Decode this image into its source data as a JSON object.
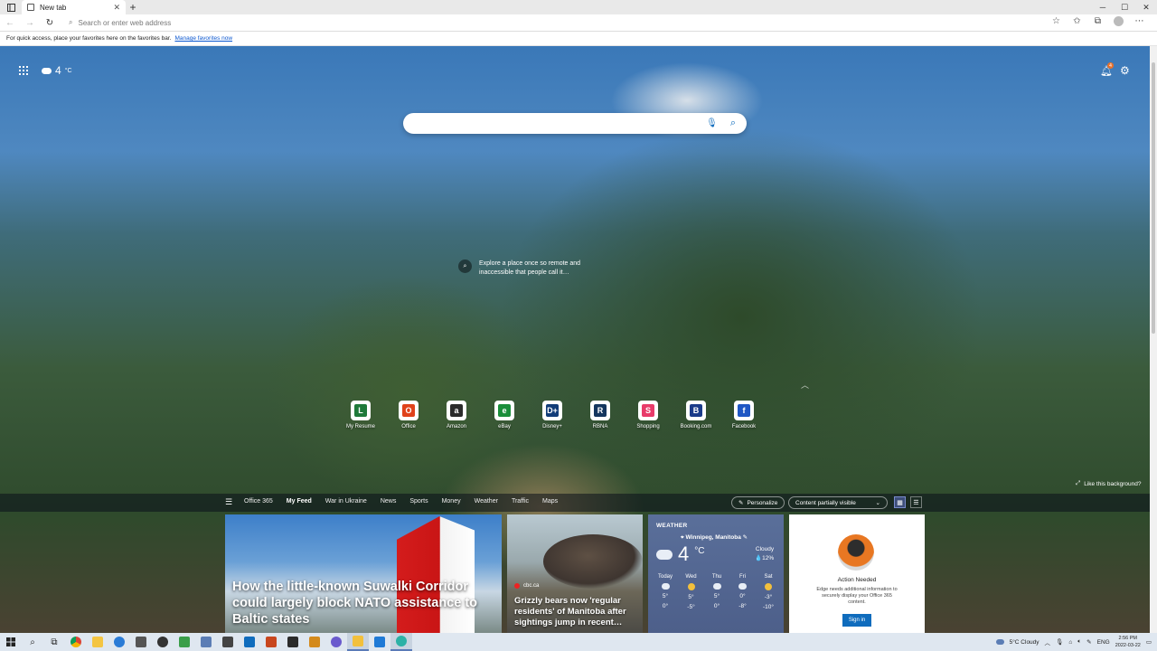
{
  "browser": {
    "tab_title": "New tab",
    "address_placeholder": "Search or enter web address",
    "favorites_hint": "For quick access, place your favorites here on the favorites bar.",
    "favorites_link": "Manage favorites now"
  },
  "ntp": {
    "temperature": "4",
    "temp_unit": "°C",
    "notification_count": "4",
    "explore_text": "Explore a place once so remote and inaccessible that people call it…",
    "like_background": "Like this background?",
    "quicklinks": [
      {
        "label": "My Resume",
        "letter": "L",
        "color": "#1f7a3a"
      },
      {
        "label": "Office",
        "letter": "O",
        "color": "#e0421b"
      },
      {
        "label": "Amazon",
        "letter": "a",
        "color": "#2b2b2b"
      },
      {
        "label": "eBay",
        "letter": "e",
        "color": "#1a8e3a"
      },
      {
        "label": "Disney+",
        "letter": "D+",
        "color": "#113c78"
      },
      {
        "label": "RBNA",
        "letter": "R",
        "color": "#14365e"
      },
      {
        "label": "Shopping",
        "letter": "S",
        "color": "#e83b6a"
      },
      {
        "label": "Booking.com",
        "letter": "B",
        "color": "#1a3b8a"
      },
      {
        "label": "Facebook",
        "letter": "f",
        "color": "#1f57c4"
      }
    ]
  },
  "feed": {
    "nav_items": [
      "Office 365",
      "My Feed",
      "War in Ukraine",
      "News",
      "Sports",
      "Money",
      "Weather",
      "Traffic",
      "Maps"
    ],
    "active_item": "My Feed",
    "personalize": "Personalize",
    "content_visibility": "Content partially visible"
  },
  "cards": {
    "nato_title": "How the little-known Suwalki Corridor could largely block NATO assistance to Baltic states",
    "bear_source": "cbc.ca",
    "bear_title": "Grizzly bears now 'regular residents' of Manitoba after sightings jump in recent…",
    "weather": {
      "header": "WEATHER",
      "location": "Winnipeg, Manitoba",
      "temp": "4",
      "unit": "°C",
      "condition": "Cloudy",
      "precip": "💧12%",
      "days": [
        {
          "name": "Today",
          "hi": "5°",
          "lo": "0°",
          "icon": "cloud"
        },
        {
          "name": "Wed",
          "hi": "5°",
          "lo": "-5°",
          "icon": "sun"
        },
        {
          "name": "Thu",
          "hi": "5°",
          "lo": "0°",
          "icon": "cloud"
        },
        {
          "name": "Fri",
          "hi": "0°",
          "lo": "-8°",
          "icon": "cloud"
        },
        {
          "name": "Sat",
          "hi": "-3°",
          "lo": "-10°",
          "icon": "sun"
        }
      ]
    },
    "action": {
      "title": "Action Needed",
      "desc": "Edge needs additional information to securely display your Office 365 content.",
      "button": "Sign in"
    }
  },
  "taskbar": {
    "weather": "5°C Cloudy",
    "lang": "ENG",
    "time": "2:56 PM",
    "date": "2022-03-22"
  }
}
